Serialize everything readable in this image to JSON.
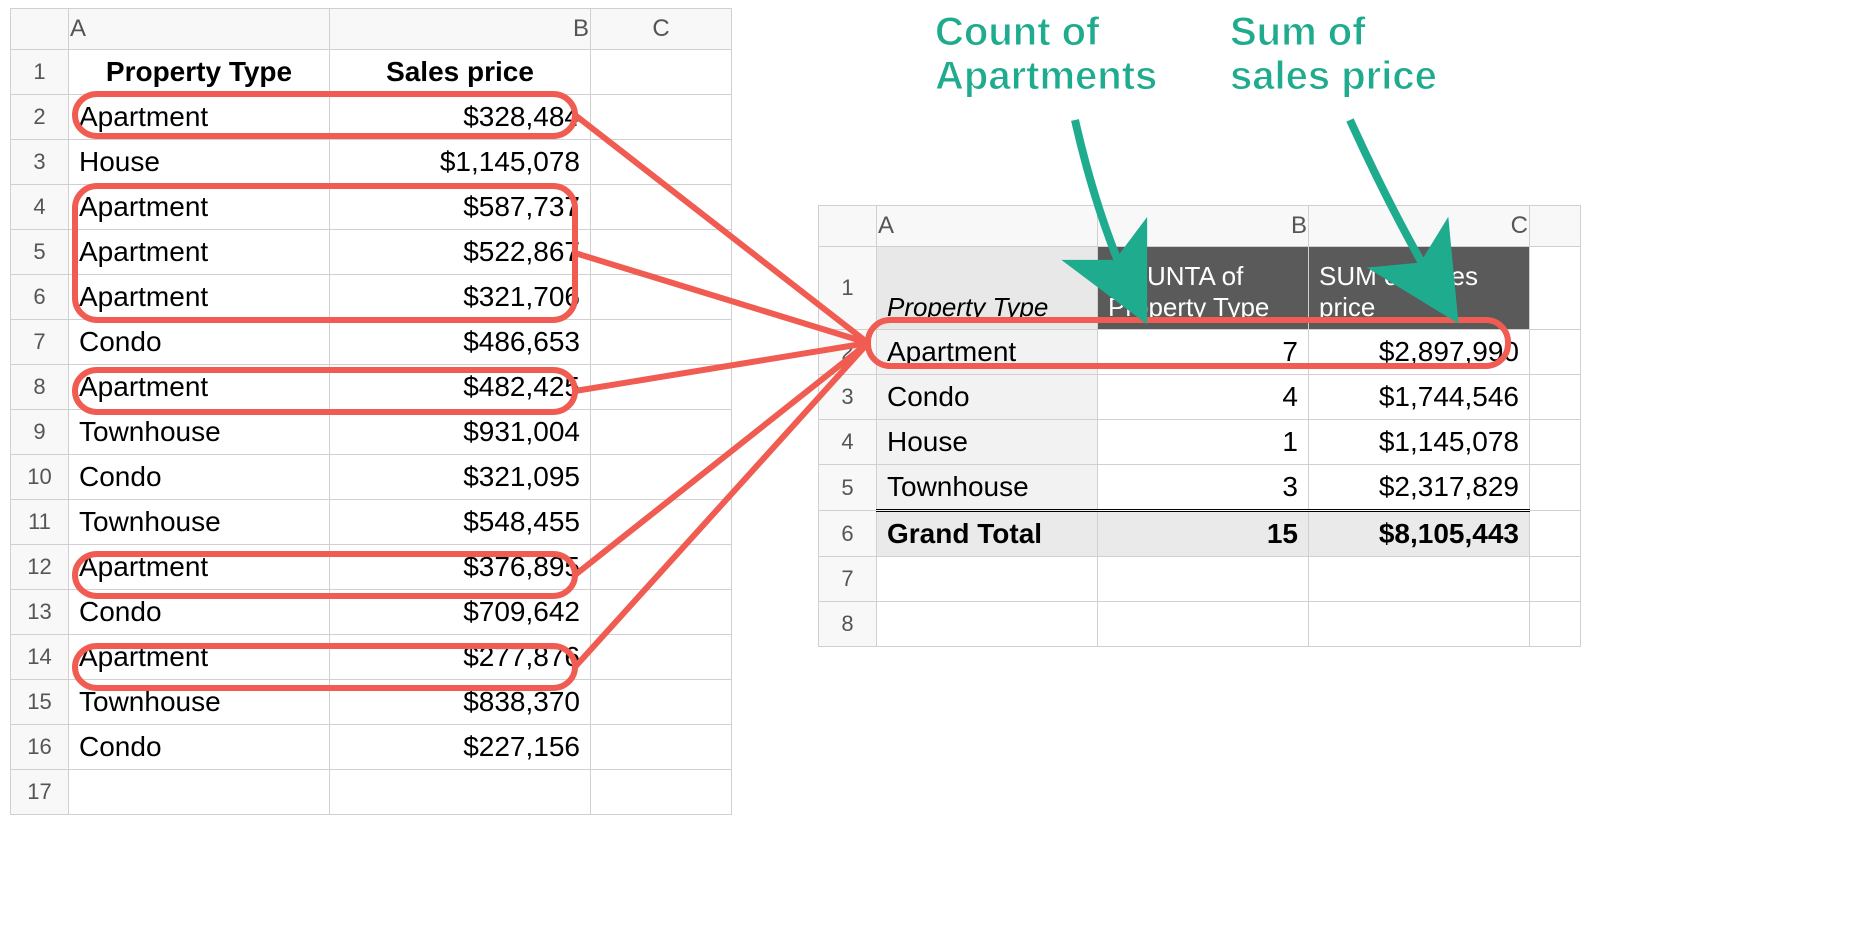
{
  "source": {
    "col_headers": [
      "A",
      "B",
      "C"
    ],
    "row_numbers": [
      1,
      2,
      3,
      4,
      5,
      6,
      7,
      8,
      9,
      10,
      11,
      12,
      13,
      14,
      15,
      16,
      17
    ],
    "header": {
      "property_type": "Property Type",
      "sales_price": "Sales price"
    },
    "rows": [
      {
        "type": "Apartment",
        "price": "$328,484",
        "apt": true
      },
      {
        "type": "House",
        "price": "$1,145,078",
        "apt": false
      },
      {
        "type": "Apartment",
        "price": "$587,737",
        "apt": true
      },
      {
        "type": "Apartment",
        "price": "$522,867",
        "apt": true
      },
      {
        "type": "Apartment",
        "price": "$321,706",
        "apt": true
      },
      {
        "type": "Condo",
        "price": "$486,653",
        "apt": false
      },
      {
        "type": "Apartment",
        "price": "$482,425",
        "apt": true
      },
      {
        "type": "Townhouse",
        "price": "$931,004",
        "apt": false
      },
      {
        "type": "Condo",
        "price": "$321,095",
        "apt": false
      },
      {
        "type": "Townhouse",
        "price": "$548,455",
        "apt": false
      },
      {
        "type": "Apartment",
        "price": "$376,895",
        "apt": true
      },
      {
        "type": "Condo",
        "price": "$709,642",
        "apt": false
      },
      {
        "type": "Apartment",
        "price": "$277,876",
        "apt": true
      },
      {
        "type": "Townhouse",
        "price": "$838,370",
        "apt": false
      },
      {
        "type": "Condo",
        "price": "$227,156",
        "apt": false
      }
    ]
  },
  "pivot": {
    "col_headers": [
      "A",
      "B",
      "C"
    ],
    "row_numbers": [
      1,
      2,
      3,
      4,
      5,
      6,
      7,
      8
    ],
    "header": {
      "property_type": "Property Type",
      "counta": "COUNTA of Property Type",
      "sum": "SUM of Sales price"
    },
    "rows": [
      {
        "type": "Apartment",
        "count": "7",
        "sum": "$2,897,990"
      },
      {
        "type": "Condo",
        "count": "4",
        "sum": "$1,744,546"
      },
      {
        "type": "House",
        "count": "1",
        "sum": "$1,145,078"
      },
      {
        "type": "Townhouse",
        "count": "3",
        "sum": "$2,317,829"
      }
    ],
    "total": {
      "label": "Grand Total",
      "count": "15",
      "sum": "$8,105,443"
    }
  },
  "annotations": {
    "count_label": "Count of Apartments",
    "sum_label": "Sum of sales price"
  },
  "colors": {
    "highlight": "#f05c52",
    "anno_teal": "#1fab8e"
  }
}
